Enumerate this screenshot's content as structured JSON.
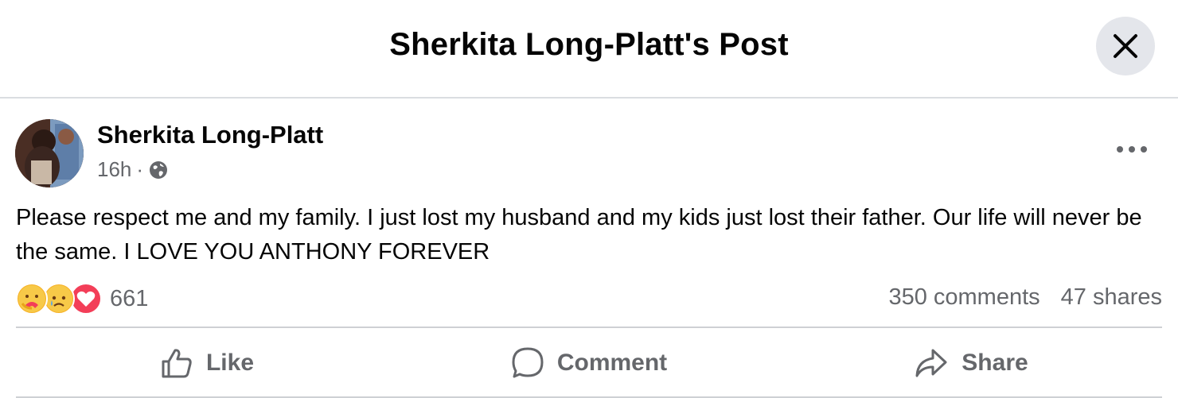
{
  "modal": {
    "title": "Sherkita Long-Platt's Post"
  },
  "post": {
    "author": "Sherkita Long-Platt",
    "time": "16h",
    "separator": "·",
    "audience_icon": "globe-icon",
    "text": "Please respect me and my family. I just lost my husband and my kids just lost their father. Our life will never be the same. I LOVE YOU ANTHONY FOREVER",
    "reactions": {
      "types": [
        "care",
        "sad",
        "love"
      ],
      "count": "661"
    },
    "comments": "350 comments",
    "shares": "47 shares"
  },
  "actions": {
    "like": "Like",
    "comment": "Comment",
    "share": "Share"
  },
  "colors": {
    "secondary_text": "#65676b",
    "divider": "#ced0d4",
    "close_bg": "#e4e6eb",
    "love": "#f33e58",
    "sad": "#f7b125"
  }
}
